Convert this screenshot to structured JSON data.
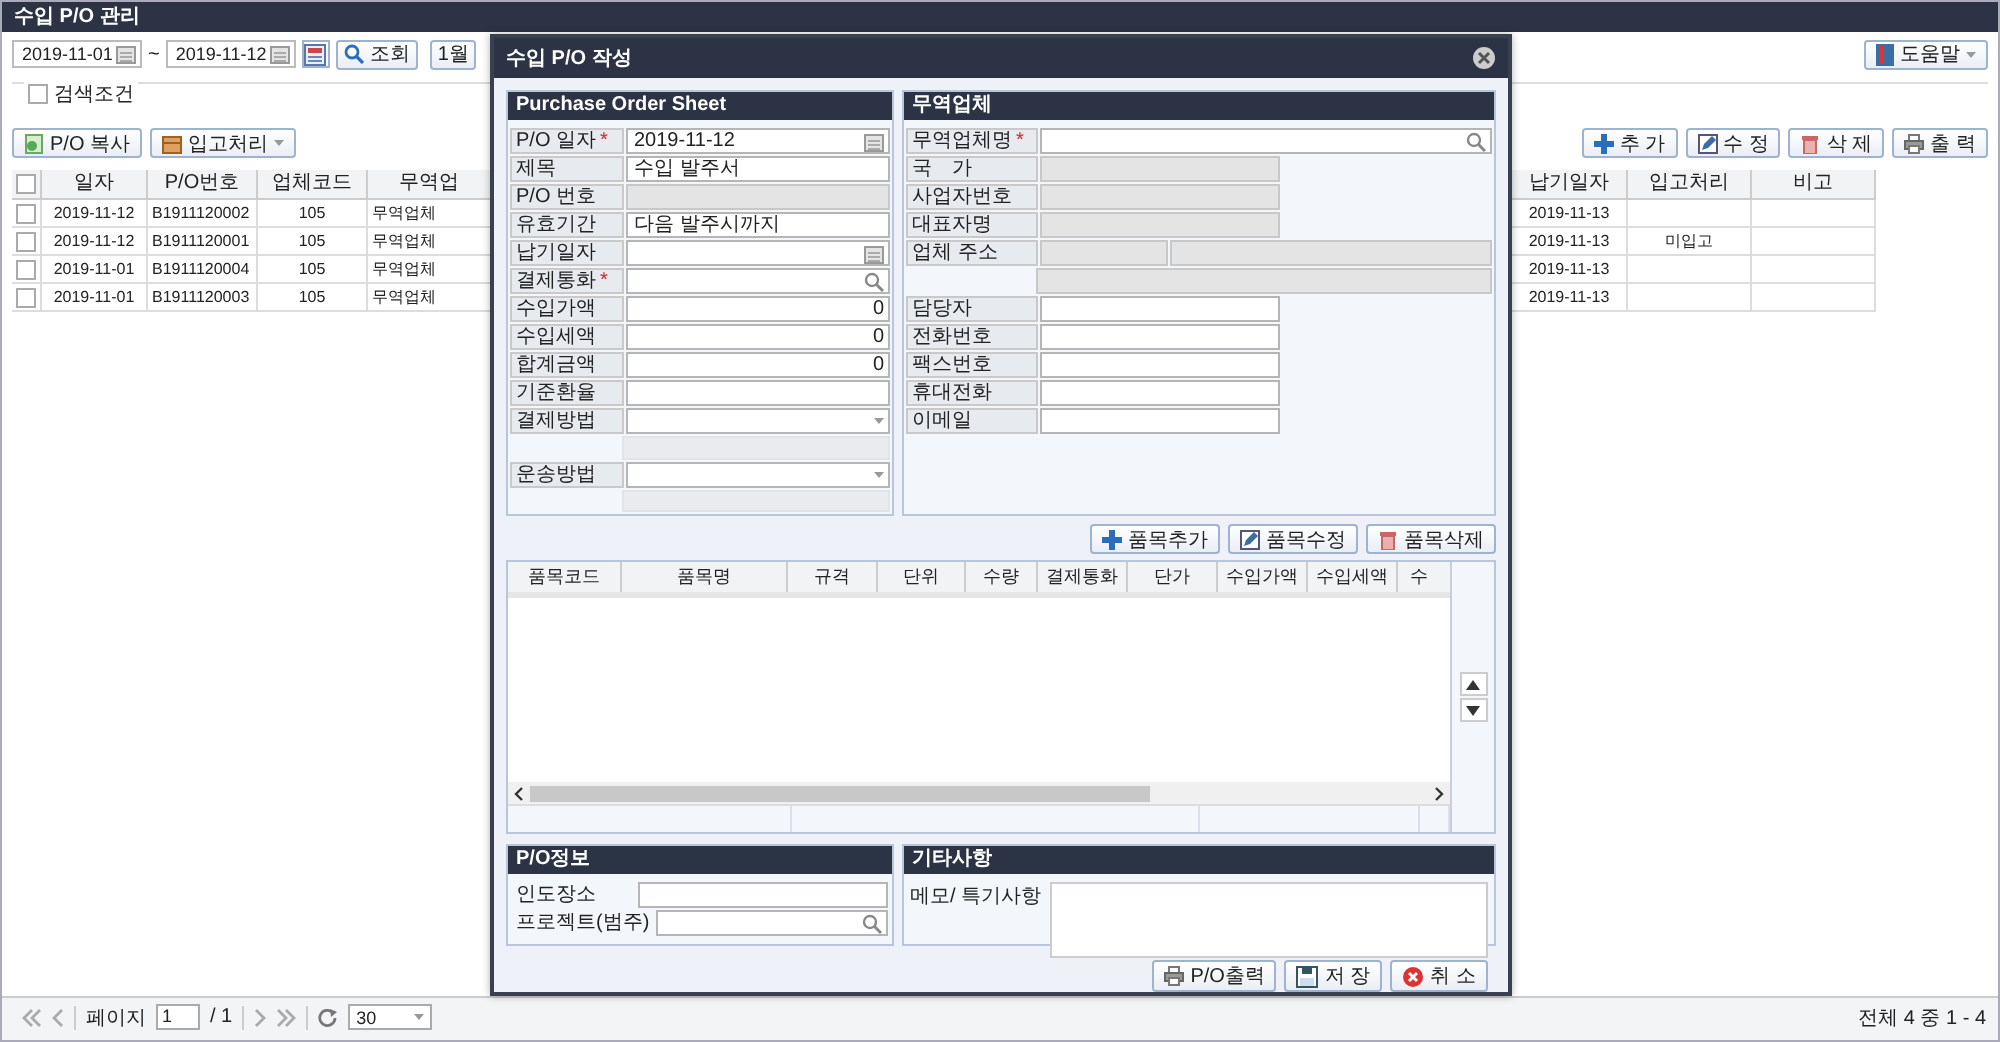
{
  "window": {
    "title": "수입 P/O 관리"
  },
  "search": {
    "date_from": "2019-11-01",
    "separator": "~",
    "date_to": "2019-11-12",
    "search_button": "조회",
    "period_buttons": [
      "1월"
    ],
    "help_button": "도움말",
    "condition": {
      "label": "검색조건",
      "checked": false
    }
  },
  "toolbar_left": [
    "P/O 복사",
    "입고처리"
  ],
  "toolbar_right": [
    "추 가",
    "수 정",
    "삭 제",
    "출 력"
  ],
  "table": {
    "header_checked": false,
    "columns": [
      "일자",
      "P/O번호",
      "업체코드",
      "무역업",
      "납기일자",
      "입고처리",
      "비고"
    ],
    "rows": [
      {
        "checked": false,
        "cells": [
          "2019-11-12",
          "B1911120002",
          "105",
          "무역업체",
          "2019-11-13",
          "",
          ""
        ]
      },
      {
        "checked": false,
        "cells": [
          "2019-11-12",
          "B1911120001",
          "105",
          "무역업체",
          "2019-11-13",
          "미입고",
          ""
        ]
      },
      {
        "checked": false,
        "cells": [
          "2019-11-01",
          "B1911120004",
          "105",
          "무역업체",
          "2019-11-13",
          "",
          ""
        ]
      },
      {
        "checked": false,
        "cells": [
          "2019-11-01",
          "B1911120003",
          "105",
          "무역업체",
          "2019-11-13",
          "",
          ""
        ]
      }
    ]
  },
  "pager": {
    "page_label": "페이지",
    "page": "1",
    "total_pages": "/ 1",
    "page_size": "30",
    "summary": "전체 4 중 1 - 4"
  },
  "dialog": {
    "title": "수입 P/O 작성",
    "order_sheet": {
      "title": "Purchase Order Sheet",
      "fields": [
        {
          "kind": "date",
          "label": "P/O 일자",
          "required": true,
          "required_mark": "*",
          "value": "2019-11-12"
        },
        {
          "kind": "text",
          "label": "제목",
          "required": false,
          "value": "수입 발주서"
        },
        {
          "kind": "readonly",
          "label": "P/O 번호",
          "required": false
        },
        {
          "kind": "text",
          "label": "유효기간",
          "required": false,
          "value": "다음 발주시까지"
        },
        {
          "kind": "date",
          "label": "납기일자",
          "required": false
        },
        {
          "kind": "lookup",
          "label": "결제통화",
          "required": true,
          "required_mark": "*"
        },
        {
          "kind": "amount",
          "label": "수입가액",
          "required": false,
          "value": "0"
        },
        {
          "kind": "amount",
          "label": "수입세액",
          "required": false,
          "value": "0"
        },
        {
          "kind": "amount",
          "label": "합계금액",
          "required": false,
          "value": "0"
        },
        {
          "kind": "text",
          "label": "기준환율",
          "required": false
        },
        {
          "kind": "select",
          "label": "결제방법",
          "required": false
        },
        {
          "kind": "blank"
        },
        {
          "kind": "select",
          "label": "운송방법",
          "required": false
        },
        {
          "kind": "blank"
        }
      ]
    },
    "vendor": {
      "title": "무역업체",
      "fields": [
        {
          "kind": "lookup",
          "label": "무역업체명",
          "required": true,
          "required_mark": "*"
        },
        {
          "kind": "readonly",
          "label": "국　가",
          "required": false
        },
        {
          "kind": "readonly",
          "label": "사업자번호",
          "required": false
        },
        {
          "kind": "readonly",
          "label": "대표자명",
          "required": false
        },
        {
          "kind": "address",
          "label": "업체 주소",
          "required": false
        },
        {
          "kind": "address2"
        },
        {
          "kind": "short",
          "label": "담당자",
          "required": false
        },
        {
          "kind": "short",
          "label": "전화번호",
          "required": false
        },
        {
          "kind": "short",
          "label": "팩스번호",
          "required": false
        },
        {
          "kind": "short",
          "label": "휴대전화",
          "required": false
        },
        {
          "kind": "short",
          "label": "이메일",
          "required": false
        }
      ]
    },
    "item_buttons": [
      "품목추가",
      "품목수정",
      "품목삭제"
    ],
    "item_columns": [
      "품목코드",
      "품목명",
      "규격",
      "단위",
      "수량",
      "결제통화",
      "단가",
      "수입가액",
      "수입세액",
      "수"
    ],
    "po_info": {
      "title": "P/O정보",
      "fields": [
        {
          "kind": "text",
          "label": "인도장소"
        },
        {
          "kind": "lookup",
          "label": "프로젝트(범주)"
        }
      ]
    },
    "remarks": {
      "title": "기타사항",
      "label": "메모/ 특기사항"
    },
    "footer_buttons": [
      "P/O출력",
      "저 장",
      "취 소"
    ]
  }
}
